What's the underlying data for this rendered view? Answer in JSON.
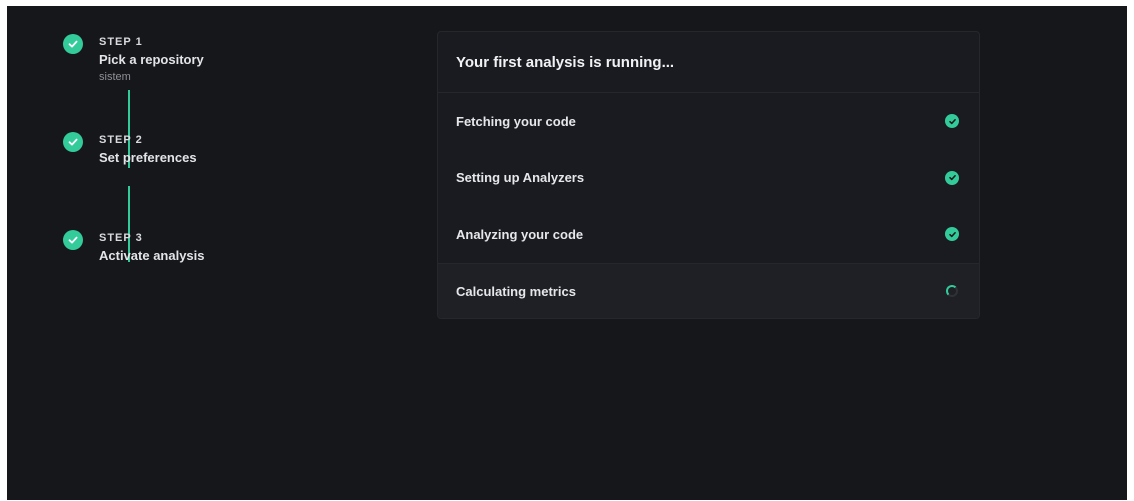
{
  "stepper": {
    "steps": [
      {
        "number": "STEP 1",
        "title": "Pick a repository",
        "subtitle": "sistem",
        "state": "complete",
        "icon": "check-icon"
      },
      {
        "number": "STEP 2",
        "title": "Set preferences",
        "state": "complete",
        "icon": "check-icon"
      },
      {
        "number": "STEP 3",
        "title": "Activate analysis",
        "state": "complete",
        "icon": "check-icon"
      }
    ]
  },
  "analysis": {
    "title": "Your first analysis is running...",
    "tasks": [
      {
        "label": "Fetching your code",
        "status": "done",
        "icon": "check-circle-icon"
      },
      {
        "label": "Setting up Analyzers",
        "status": "done",
        "icon": "check-circle-icon"
      },
      {
        "label": "Analyzing your code",
        "status": "done",
        "icon": "check-circle-icon"
      },
      {
        "label": "Calculating metrics",
        "status": "in-progress",
        "icon": "spinner-icon"
      }
    ]
  },
  "colors": {
    "background": "#16171b",
    "card": "#1a1b20",
    "accent": "#33cb9a",
    "text": "#e6e7ea",
    "muted": "#8d9097"
  }
}
